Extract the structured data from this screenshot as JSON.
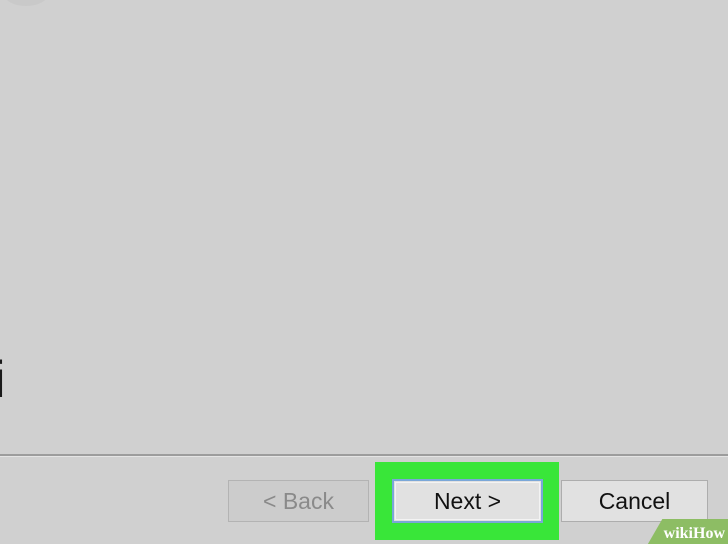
{
  "window": {
    "partial_text": "i"
  },
  "footer": {
    "back_label": "< Back",
    "next_label": "Next >",
    "cancel_label": "Cancel"
  },
  "watermark": {
    "text": "wikiHow"
  },
  "colors": {
    "background": "#d0d0d0",
    "highlight": "#39e639",
    "watermark": "#8dbd64"
  }
}
